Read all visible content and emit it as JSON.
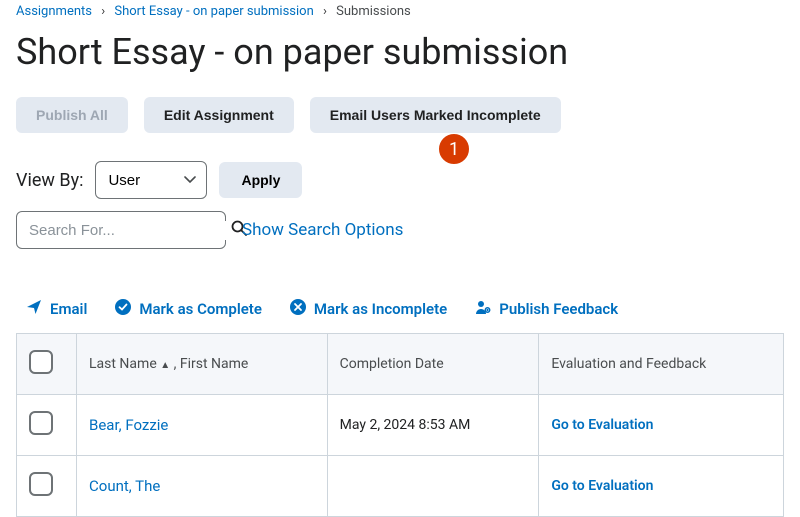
{
  "breadcrumb": {
    "items": [
      "Assignments",
      "Short Essay - on paper submission",
      "Submissions"
    ]
  },
  "page_title": "Short Essay - on paper submission",
  "buttons": {
    "publish_all": "Publish All",
    "edit_assignment": "Edit Assignment",
    "email_incomplete": "Email Users Marked Incomplete"
  },
  "annotation": {
    "badge_1": "1"
  },
  "filter": {
    "view_by_label": "View By:",
    "view_by_value": "User",
    "apply_label": "Apply"
  },
  "search": {
    "placeholder": "Search For...",
    "show_options_label": "Show Search Options"
  },
  "actions": {
    "email": "Email",
    "mark_complete": "Mark as Complete",
    "mark_incomplete": "Mark as Incomplete",
    "publish_feedback": "Publish Feedback"
  },
  "table": {
    "headers": {
      "name": "Last Name",
      "name_suffix": " , First Name",
      "completion": "Completion Date",
      "evaluation": "Evaluation and Feedback"
    },
    "rows": [
      {
        "name": "Bear, Fozzie",
        "completion": "May 2, 2024 8:53 AM",
        "eval_link": "Go to Evaluation"
      },
      {
        "name": "Count, The",
        "completion": "",
        "eval_link": "Go to Evaluation"
      }
    ]
  }
}
